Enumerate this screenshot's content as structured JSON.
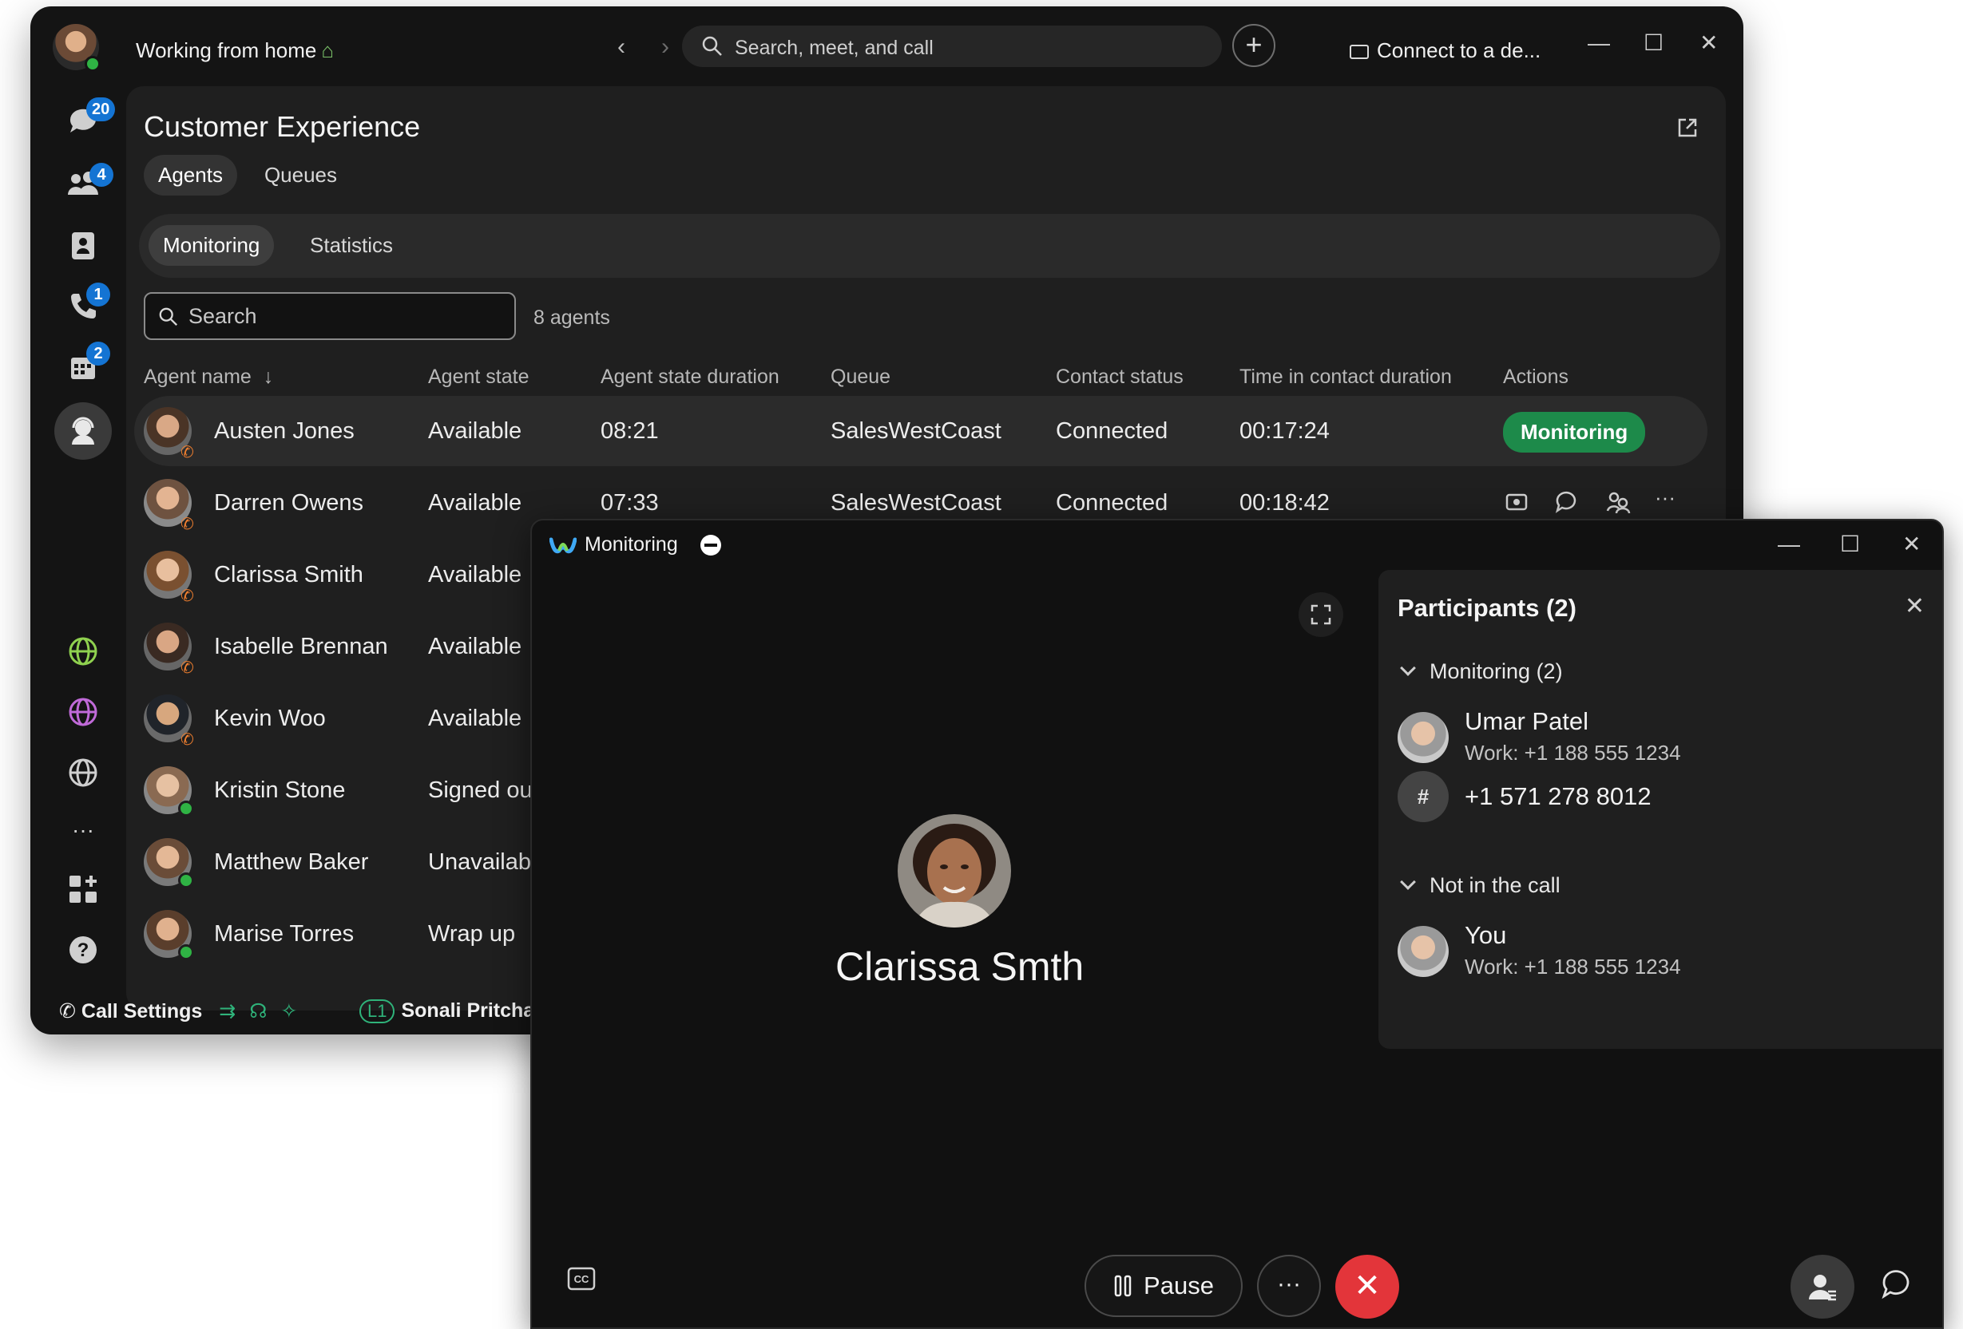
{
  "main": {
    "user_status": "Working from home",
    "search_placeholder": "Search, meet, and call",
    "connect_device": "Connect to a de...",
    "badges": {
      "messages": "20",
      "teams": "4",
      "calls": "1",
      "meetings": "2"
    },
    "page_title": "Customer Experience",
    "tabs": [
      "Agents",
      "Queues"
    ],
    "subtabs": [
      "Monitoring",
      "Statistics"
    ],
    "agent_search_placeholder": "Search",
    "agents_count": "8 agents",
    "columns": [
      "Agent name",
      "Agent state",
      "Agent state duration",
      "Queue",
      "Contact status",
      "Time in contact duration",
      "Actions"
    ],
    "rows": [
      {
        "name": "Austen Jones",
        "state": "Available",
        "duration": "08:21",
        "queue": "SalesWestCoast",
        "contact": "Connected",
        "contact_duration": "00:17:24",
        "action": "Monitoring"
      },
      {
        "name": "Darren Owens",
        "state": "Available",
        "duration": "07:33",
        "queue": "SalesWestCoast",
        "contact": "Connected",
        "contact_duration": "00:18:42"
      },
      {
        "name": "Clarissa Smith",
        "state": "Available"
      },
      {
        "name": "Isabelle Brennan",
        "state": "Available"
      },
      {
        "name": "Kevin Woo",
        "state": "Available"
      },
      {
        "name": "Kristin Stone",
        "state": "Signed ou"
      },
      {
        "name": "Matthew Baker",
        "state": "Unavailabl"
      },
      {
        "name": "Marise Torres",
        "state": "Wrap up"
      }
    ],
    "footer": {
      "call_settings": "Call Settings",
      "line": "L1",
      "line_user": "Sonali Pritcha"
    }
  },
  "monitor": {
    "title": "Monitoring",
    "caller_name": "Clarissa Smth",
    "participants": {
      "heading": "Participants (2)",
      "monitoring_section": "Monitoring (2)",
      "not_in_call_section": "Not in the call",
      "p1_name": "Umar Patel",
      "p1_sub": "Work: +1 188 555 1234",
      "p2_hash": "#",
      "p2_name": "+1 571 278 8012",
      "p3_name": "You",
      "p3_sub": "Work: +1 188 555 1234"
    },
    "pause_label": "Pause",
    "more_label": "···"
  },
  "colors": {
    "accent_green": "#1d8a4a",
    "end_call_red": "#e3353a",
    "badge_blue": "#1474d3",
    "presence_green": "#2fb344",
    "phone_orange": "#f07f2f"
  },
  "icons": [
    "search-icon",
    "plus-icon",
    "chat-icon",
    "teams-icon",
    "contacts-icon",
    "phone-icon",
    "calendar-icon",
    "agent-icon",
    "globe-icon",
    "apps-icon",
    "help-icon",
    "popout-icon",
    "sort-down-icon",
    "fullscreen-icon",
    "cc-icon",
    "pause-icon",
    "end-call-icon",
    "participants-icon",
    "close-icon"
  ]
}
